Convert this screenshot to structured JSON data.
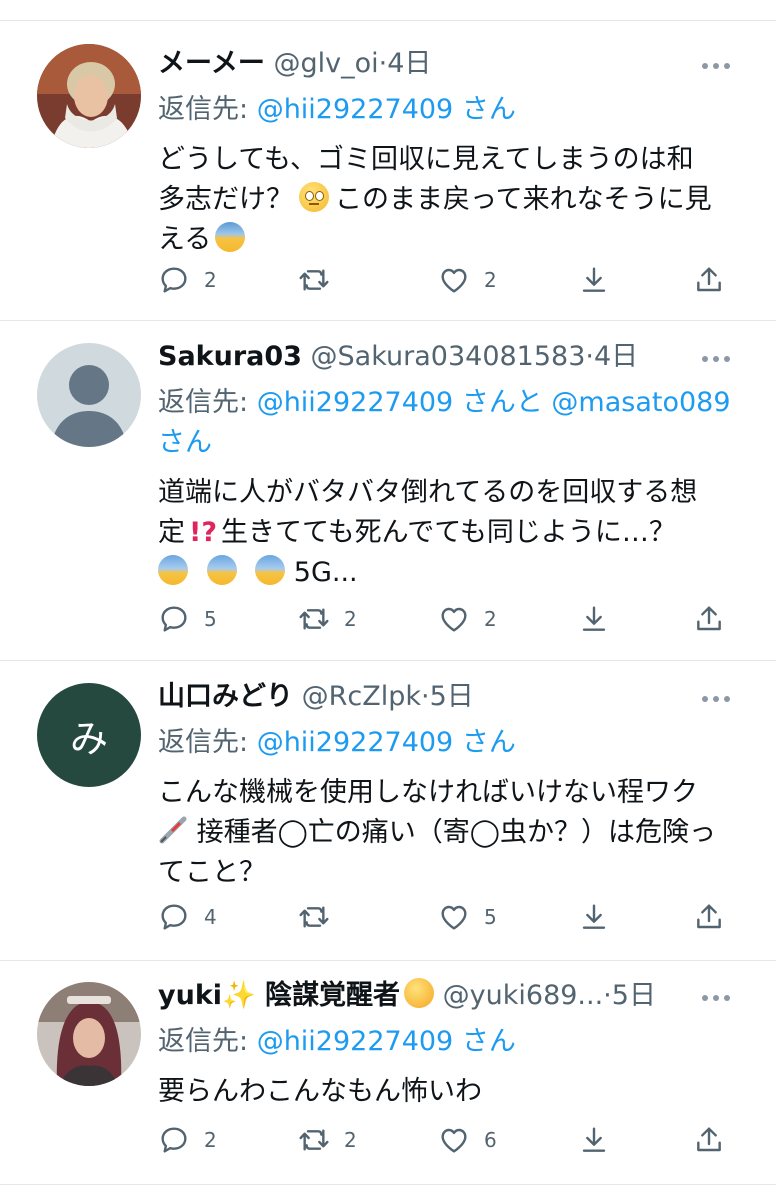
{
  "tweets": [
    {
      "name": "メーメー",
      "handle": "@glv_oi",
      "time": "4日",
      "reply_prefix": "返信先: ",
      "reply_mention": "@hii29227409",
      "reply_suffix": "さん",
      "body_lines": [
        "どうしても、ゴミ回収に見えてしまうのは和",
        "多志だけ？",
        "このまま戻って来れなそうに見",
        "える"
      ],
      "reply_count": "2",
      "retweet_count": "",
      "like_count": "2"
    },
    {
      "name": "Sakura03",
      "handle": "@Sakura034081583",
      "time": "4日",
      "reply_prefix": "返信先: ",
      "reply_mention": "@hii29227409",
      "reply_mid": "さんと ",
      "reply_mention2": "@masato089",
      "reply_suffix": "さん",
      "body_lines": [
        "道端に人がバタバタ倒れてるのを回収する想",
        "定",
        "生きてても死んでても同じように…？",
        "5G..."
      ],
      "reply_count": "5",
      "retweet_count": "2",
      "like_count": "2"
    },
    {
      "name": "山口みどり",
      "handle": "@RcZlpk",
      "time": "5日",
      "avatar_letter": "み",
      "reply_prefix": "返信先: ",
      "reply_mention": "@hii29227409",
      "reply_suffix": "さん",
      "body_lines": [
        "こんな機械を使用しなければいけない程ワク",
        "接種者◯亡の痛い（寄◯虫か？）は危険っ",
        "てこと？"
      ],
      "reply_count": "4",
      "retweet_count": "",
      "like_count": "5"
    },
    {
      "name": "yuki✨ 陰謀覚醒者",
      "handle": "@yuki689...",
      "time": "5日",
      "reply_prefix": "返信先: ",
      "reply_mention": "@hii29227409",
      "reply_suffix": "さん",
      "body_lines": [
        "要らんわこんなもん怖いわ"
      ],
      "reply_count": "2",
      "retweet_count": "2",
      "like_count": "6"
    }
  ],
  "separator_dot": "·",
  "icons": {
    "reply": "speech-bubble-icon",
    "retweet": "retweet-icon",
    "like": "heart-icon",
    "save": "download-icon",
    "share": "share-icon",
    "more": "more-dots-icon"
  },
  "colors": {
    "mention": "#1d9bf0",
    "secondary": "#536471",
    "avatar_green": "#25493f"
  }
}
